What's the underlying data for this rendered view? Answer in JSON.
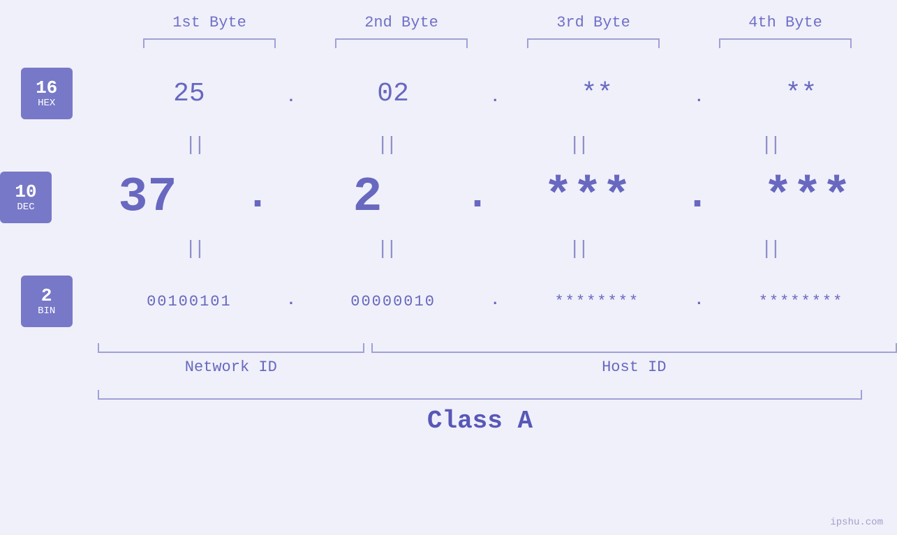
{
  "header": {
    "col1": "1st Byte",
    "col2": "2nd Byte",
    "col3": "3rd Byte",
    "col4": "4th Byte"
  },
  "badges": [
    {
      "num": "16",
      "base": "HEX"
    },
    {
      "num": "10",
      "base": "DEC"
    },
    {
      "num": "2",
      "base": "BIN"
    }
  ],
  "rows": {
    "hex": {
      "val1": "25",
      "val2": "02",
      "val3": "**",
      "val4": "**"
    },
    "dec": {
      "val1": "37",
      "val2": "2",
      "val3": "***",
      "val4": "***"
    },
    "bin": {
      "val1": "00100101",
      "val2": "00000010",
      "val3": "********",
      "val4": "********"
    }
  },
  "labels": {
    "network_id": "Network ID",
    "host_id": "Host ID",
    "class": "Class A"
  },
  "watermark": "ipshu.com"
}
